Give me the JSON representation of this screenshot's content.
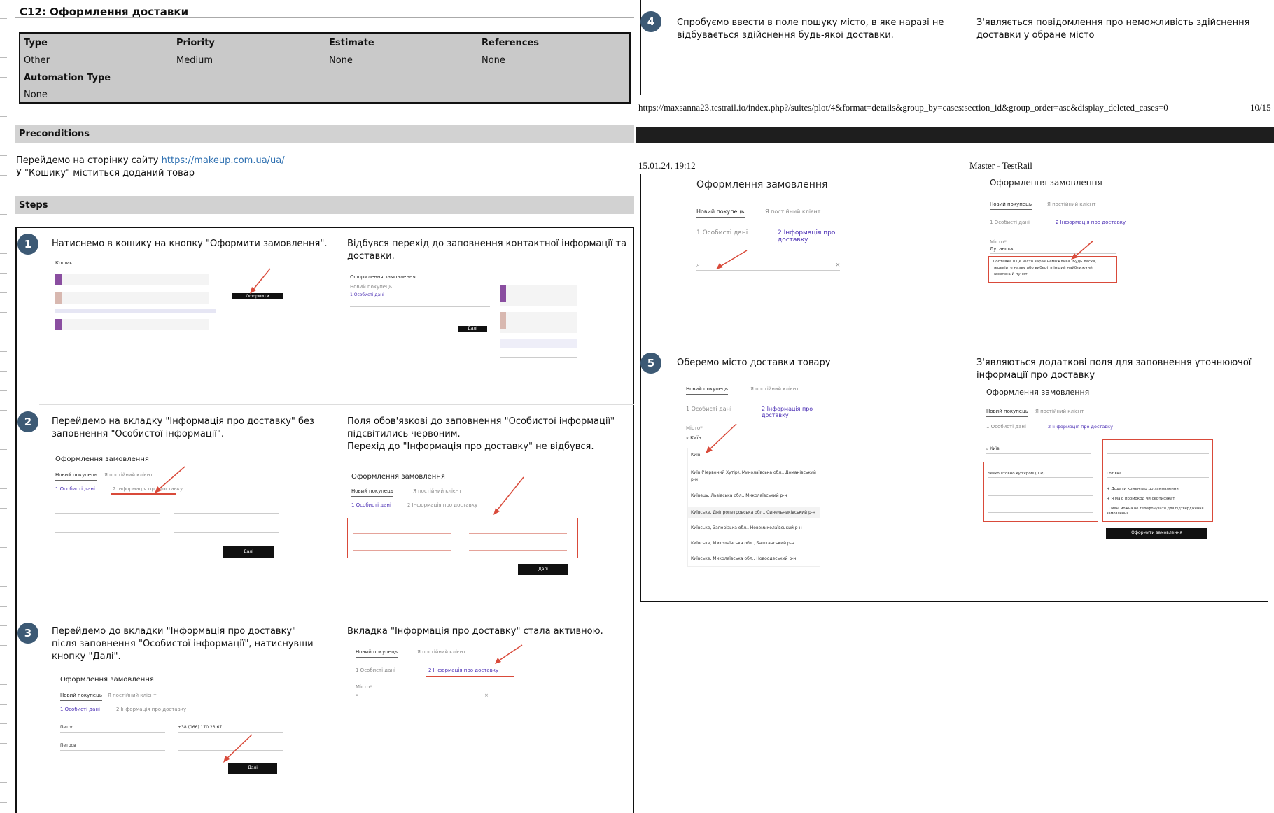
{
  "case_title": "C12: Оформлення доставки",
  "properties": {
    "headers": [
      "Type",
      "Priority",
      "Estimate",
      "References"
    ],
    "values": [
      "Other",
      "Medium",
      "None",
      "None"
    ],
    "automation_label": "Automation Type",
    "automation_value": "None"
  },
  "preconditions": {
    "title": "Preconditions",
    "line1_prefix": "Перейдемо на сторінку сайту ",
    "line1_link": "https://makeup.com.ua/ua/",
    "line2": "У \"Кошику\" міститься доданий товар"
  },
  "steps_title": "Steps",
  "steps": [
    {
      "num": "1",
      "action": "Натиснемо в кошику на кнопку \"Оформити замовлення\".",
      "expected": "Відбувся перехід до заповнення контактної інформації та доставки."
    },
    {
      "num": "2",
      "action": "Перейдемо на вкладку \"Інформація про доставку\" без заповнення \"Особистої інформації\".",
      "expected": "Поля  обов'язкові до заповнення \"Особистої інформації\" підсвітились червоним.\nПерехід до \"Інформація про доставку\" не відбувся."
    },
    {
      "num": "3",
      "action": "Перейдемо до вкладки \"Інформація про доставку\" після заповнення \"Особистої інформації\", натиснувши кнопку \"Далі\".",
      "expected": "Вкладка \"Інформація про доставку\" стала активною."
    },
    {
      "num": "4",
      "action": "Спробуємо ввести в поле пошуку місто, в яке наразі не відбувається здійснення будь-якої доставки.",
      "expected": "З'являється повідомлення про неможливість здійснення доставки у обране місто"
    },
    {
      "num": "5",
      "action": "Оберемо місто доставки товару",
      "expected": "З'являються додаткові поля для заповнення уточнюючої інформації про доставку"
    }
  ],
  "footer": {
    "url": "https://maxsanna23.testrail.io/index.php?/suites/plot/4&format=details&group_by=cases:section_id&group_order=asc&display_deleted_cases=0",
    "page": "10/15"
  },
  "page_header": {
    "date": "15.01.24, 19:12",
    "app": "Master - TestRail"
  },
  "shots": {
    "order_title": "Оформлення замовлення",
    "tab_new": "Новий покупець",
    "tab_regular": "Я постійний клієнт",
    "step_personal": "1  Особисті дані",
    "step_delivery": "2  Інформація про доставку",
    "city_label": "Місто*",
    "city_kyiv": "Київ",
    "city_lugansk": "Луганськ",
    "next_btn": "Далі",
    "cart_title": "Кошик",
    "checkout_btn": "Оформити замовлення",
    "name_value": "Петро",
    "surname_value": "Петров",
    "phone_value": "+38 (066) 170 23 67",
    "lugansk_msg": "Доставка в це місто зараз неможлива. Будь ласка, перевірте назву або виберіть інший найближчий населений пункт",
    "city_suggestions": [
      "Київ",
      "Київ (Червоний Хутір), Миколаївська обл., Доманівський р-н",
      "Київець, Львівська обл., Миколаївський р-н",
      "Київське, Дніпропетровська обл., Синельниківський р-н",
      "Київське, Запорізька обл., Новомиколаївський р-н",
      "Київське, Миколаївська обл., Баштанський р-н",
      "Київське, Миколаївська обл., Новоодеський р-н"
    ],
    "delivery_method": "Безкоштовно кур'єром (0 ₴)",
    "payment": "Готівка",
    "add_comment": "+ Додати коментар до замовлення",
    "promo": "+ Я маю промокод чи сертифікат",
    "no_call": "Мені можна не телефонувати для підтвердження замовлення"
  }
}
